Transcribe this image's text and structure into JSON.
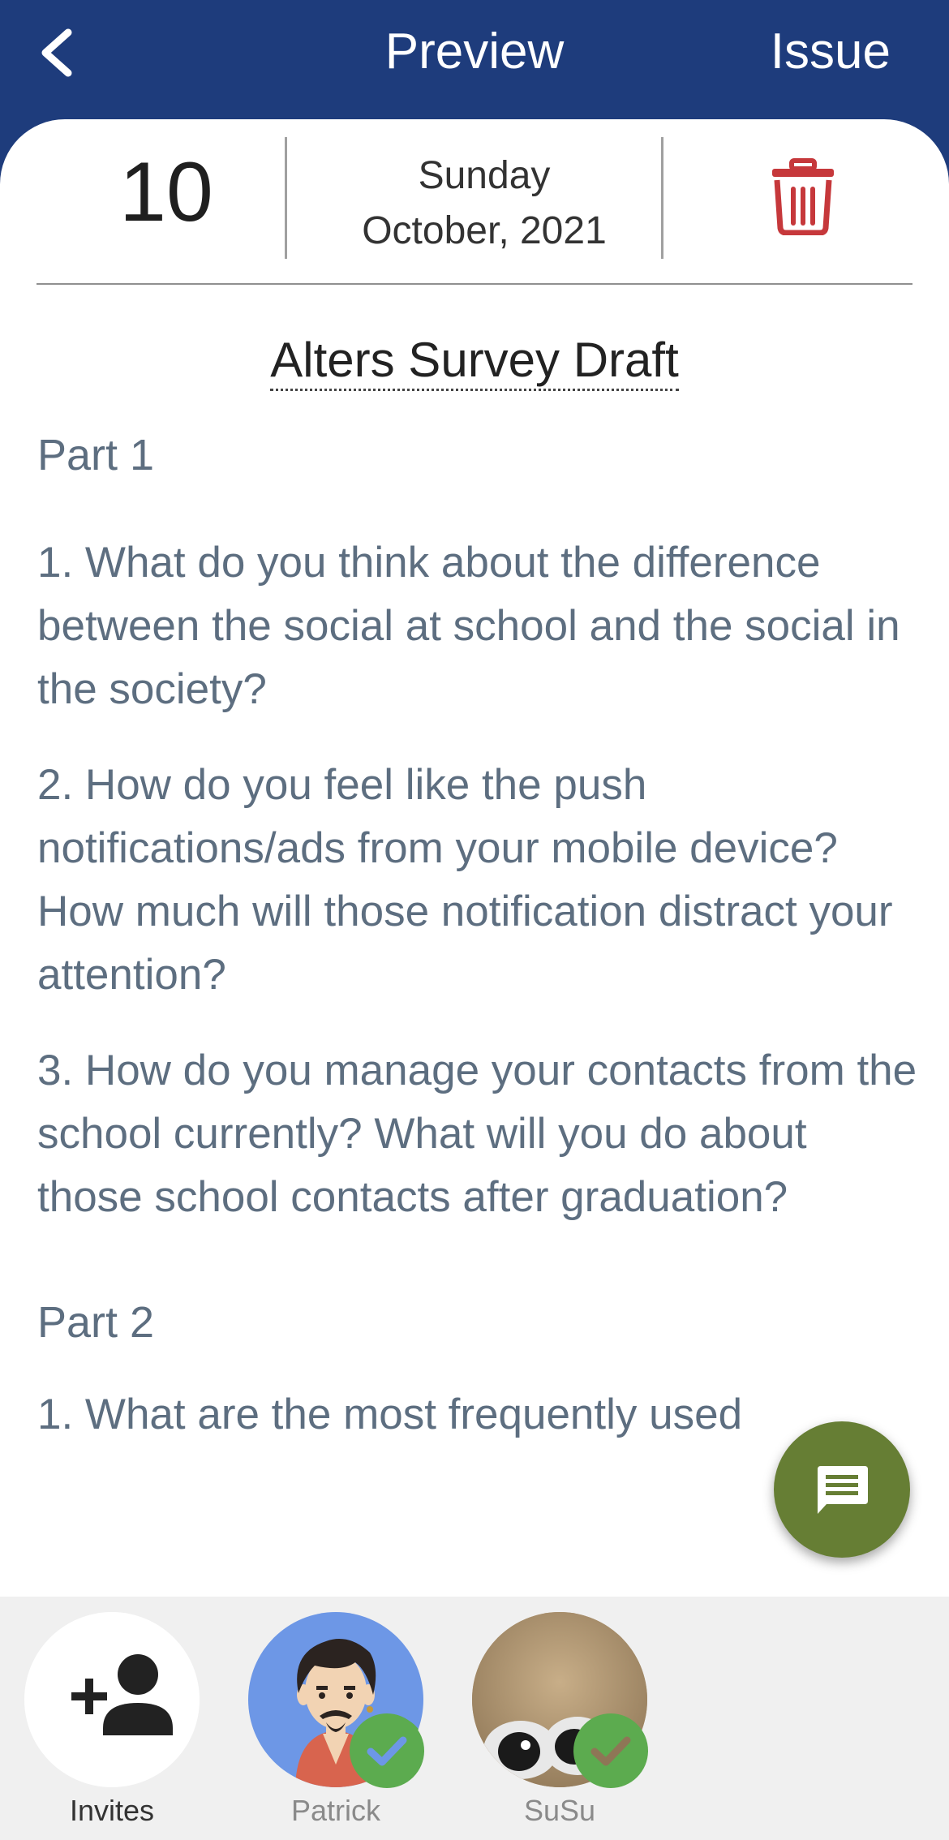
{
  "header": {
    "title": "Preview",
    "issue_label": "Issue",
    "back_icon": "chevron-left-icon",
    "background_color": "#1e3c7c"
  },
  "date": {
    "day": "10",
    "weekday": "Sunday",
    "month_year": "October, 2021"
  },
  "delete_icon": "trash-icon",
  "delete_icon_color": "#c6383b",
  "document": {
    "title": "Alters Survey Draft",
    "part1": "Part 1",
    "q1": "1. What do you think about the difference between the social at school and the social in the society?",
    "q2": "2. How do you feel like the push notifications/ads from your mobile device? How much will those notification distract your attention?",
    "q3": "3. How do you manage your contacts from the school currently? What will you do about those school contacts after graduation?",
    "part2": "Part 2",
    "part2_q1": "1. What are the most frequently used"
  },
  "fab": {
    "icon": "chat-icon",
    "color": "#667e34"
  },
  "invitees": {
    "invite_label": "Invites",
    "invite_icon": "add-person-icon",
    "people": [
      {
        "name": "Patrick",
        "status_icon": "check-icon"
      },
      {
        "name": "SuSu",
        "status_icon": "check-icon"
      }
    ]
  }
}
